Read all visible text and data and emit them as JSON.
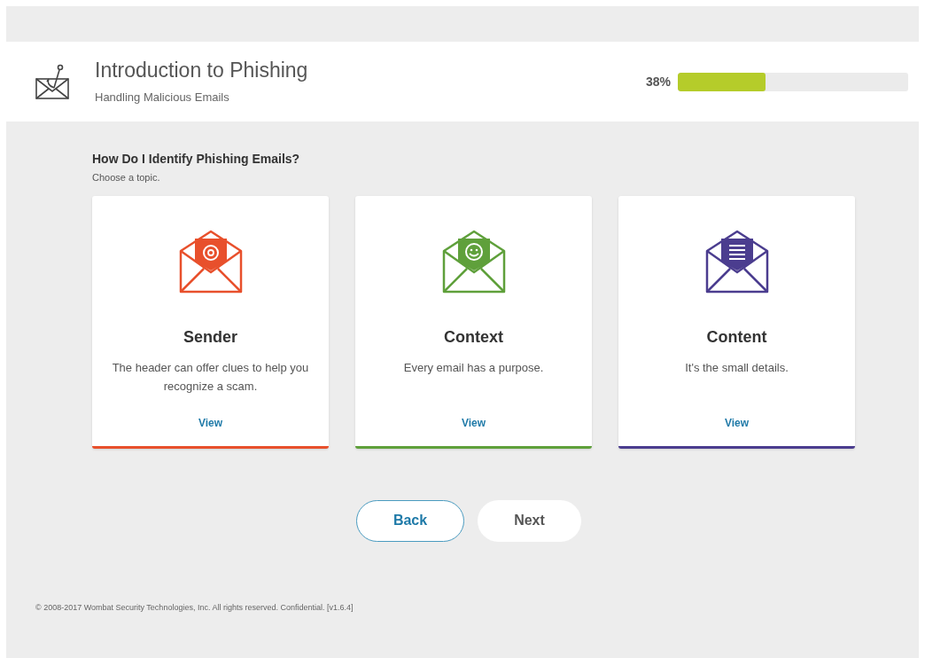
{
  "course": {
    "title": "Introduction to Phishing",
    "subtitle": "Handling Malicious Emails"
  },
  "progress": {
    "label": "38%",
    "level": 0.38
  },
  "prompt": {
    "heading": "How Do I Identify Phishing Emails?",
    "instruction": "Choose a topic."
  },
  "topics": [
    {
      "kind": "at",
      "title": "Sender",
      "description": "The header can offer clues to help you recognize a scam.",
      "link": "View",
      "color": "#e8502c"
    },
    {
      "kind": "smile",
      "title": "Context",
      "description": "Every email has a purpose.",
      "link": "View",
      "color": "#5fa03b"
    },
    {
      "kind": "lines",
      "title": "Content",
      "description": "It's the small details.",
      "link": "View",
      "color": "#4b3d8f"
    }
  ],
  "buttons": [
    {
      "kind": "outline",
      "label": "Back"
    },
    {
      "kind": "plain",
      "label": "Next"
    }
  ],
  "footer": "© 2008-2017 Wombat Security Technologies, Inc. All rights reserved. Confidential. [v1.6.4]"
}
